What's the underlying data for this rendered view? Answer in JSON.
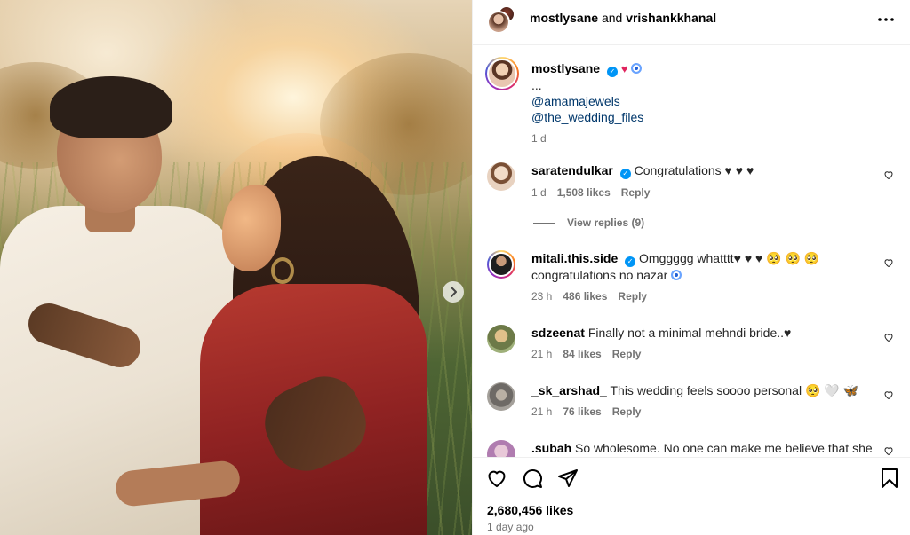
{
  "post": {
    "header": {
      "author": "mostlysane",
      "joiner": "and",
      "coauthor": "vrishankkhanal"
    },
    "caption": {
      "username": "mostlysane",
      "ellipsis": "...",
      "mentions": [
        "@amamajewels",
        "@the_wedding_files"
      ],
      "time": "1 d"
    },
    "comments": [
      {
        "username": "saratendulkar",
        "verified": true,
        "text": "Congratulations ♥ ♥ ♥",
        "time": "1 d",
        "likes": "1,508 likes",
        "reply": "Reply",
        "avatar_color": "#e9d8c8"
      },
      {
        "username": "mitali.this.side",
        "verified": true,
        "text": "Omggggg whatttt♥ ♥ ♥ 🥺 🥺 🥺",
        "text2": "congratulations no nazar",
        "time": "23 h",
        "likes": "486 likes",
        "reply": "Reply",
        "avatar_color": "#2c2c2c"
      },
      {
        "username": "sdzeenat",
        "verified": false,
        "text": "Finally not a minimal mehndi bride..♥",
        "time": "21 h",
        "likes": "84 likes",
        "reply": "Reply",
        "avatar_color": "#a8b58a"
      },
      {
        "username": "_sk_arshad_",
        "verified": false,
        "text": "This wedding feels soooo personal 🥺 🤍 🦋",
        "time": "21 h",
        "likes": "76 likes",
        "reply": "Reply",
        "avatar_color": "#8d8d8d"
      },
      {
        "username": ".subah",
        "verified": false,
        "text": "So wholesome. No one can make me believe that she",
        "avatar_color": "#c9a7c9"
      }
    ],
    "view_replies": "View replies (9)",
    "likes_count": "2,680,456 likes",
    "posted_ago": "1 day ago"
  },
  "icons": {
    "more": "more-icon",
    "like": "heart-icon",
    "comment": "comment-icon",
    "share": "share-icon",
    "save": "bookmark-icon",
    "next": "chevron-right-icon"
  },
  "colors": {
    "accent": "#0095f6",
    "link": "#00376b",
    "muted": "#737373",
    "heart": "#e0245e"
  }
}
